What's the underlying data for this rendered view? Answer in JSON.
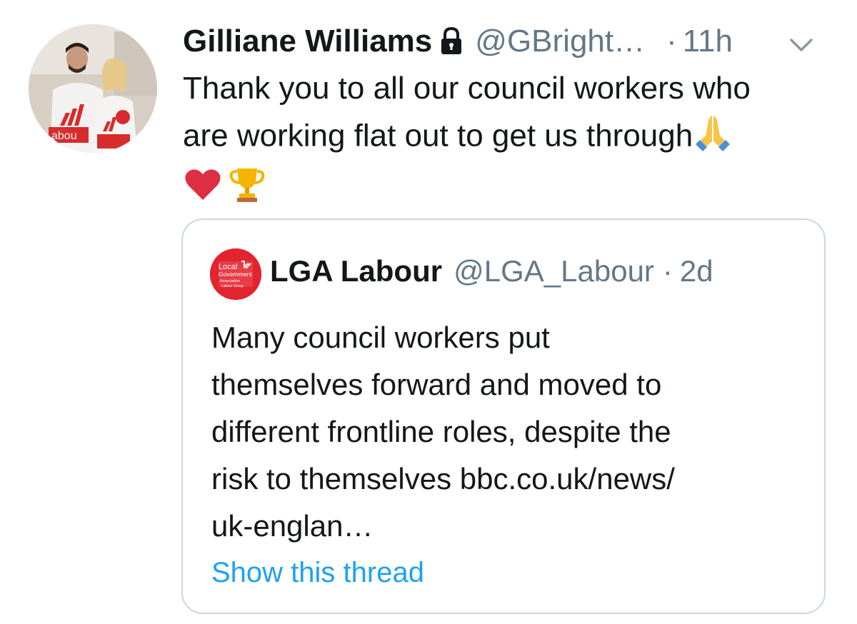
{
  "tweet": {
    "display_name": "Gilliane Williams",
    "handle": "@GBright…",
    "separator": "·",
    "time": "11h",
    "text_lines": [
      "Thank you to all our council workers who",
      "are working flat out to get us through"
    ],
    "emojis": [
      "folded-hands",
      "red-heart",
      "trophy"
    ],
    "protected_icon": "lock-icon",
    "menu_icon": "chevron-down-icon"
  },
  "avatar": {
    "shirt_text": "abou"
  },
  "quoted_tweet": {
    "display_name": "LGA Labour",
    "handle": "@LGA_Labour",
    "separator": "·",
    "time": "2d",
    "avatar_logo_lines": [
      "Local",
      "Government",
      "Association",
      "Labour Group"
    ],
    "text_lines": [
      "Many council workers put",
      "themselves forward and moved to",
      "different frontline roles, despite the",
      "risk to themselves bbc.co.uk/news/",
      "uk-englan…"
    ],
    "show_thread_label": "Show this thread"
  },
  "colors": {
    "text_primary": "#14171a",
    "text_secondary": "#657786",
    "link": "#1da1f2",
    "border": "#ccd6dd",
    "lga_red": "#e3232e",
    "labour_red": "#d62c2c"
  }
}
